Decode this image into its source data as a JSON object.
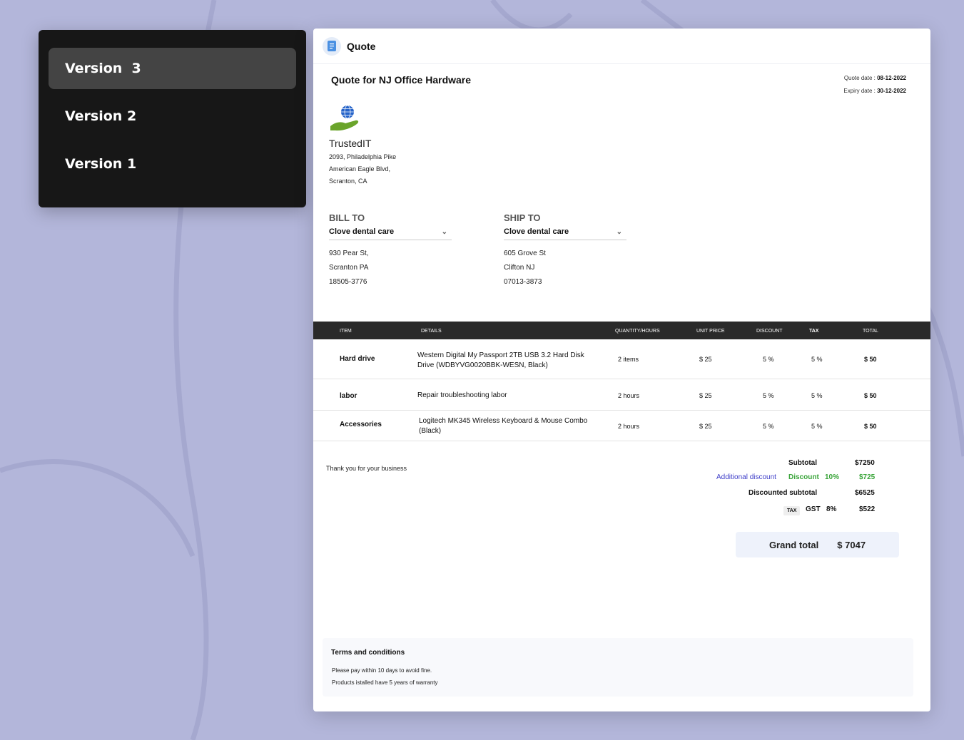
{
  "versions": [
    "Version  3",
    "Version 2",
    "Version 1"
  ],
  "doc": {
    "title": "Quote",
    "quote_for": "Quote for NJ Office Hardware",
    "quote_date_label": "Quote date : ",
    "quote_date": "08-12-2022",
    "expiry_date_label": "Expiry date : ",
    "expiry_date": "30-12-2022"
  },
  "company": {
    "name": "TrustedIT",
    "address": [
      "2093, Philadelphia Pike",
      "American Eagle Blvd,",
      "Scranton, CA"
    ]
  },
  "bill_to": {
    "heading": "BILL TO",
    "name": "Clove dental care",
    "address": [
      "930 Pear St,",
      "Scranton PA",
      "18505-3776"
    ]
  },
  "ship_to": {
    "heading": "SHIP TO",
    "name": "Clove dental care",
    "address": [
      "605 Grove St",
      "Clifton NJ",
      "07013-3873"
    ]
  },
  "table": {
    "headers": [
      "ITEM",
      "DETAILS",
      "QUANTITY/HOURS",
      "UNIT PRICE",
      "DISCOUNT",
      "TAX",
      "TOTAL"
    ],
    "rows": [
      [
        "Hard drive",
        "Western Digital My Passport 2TB USB 3.2 Hard Disk Drive (WDBYVG0020BBK-WESN, Black)",
        "2 items",
        "$ 25",
        "5 %",
        "5 %",
        "$ 50"
      ],
      [
        "labor",
        "Repair troubleshooting labor",
        "2 hours",
        "$ 25",
        "5 %",
        "5 %",
        "$ 50"
      ],
      [
        "Accessories",
        "Logitech MK345 Wireless Keyboard & Mouse Combo (Black)",
        "2 hours",
        "$ 25",
        "5 %",
        "5 %",
        "$ 50"
      ]
    ]
  },
  "thanks": "Thank you for your business",
  "summary": {
    "subtotal_label": "Subtotal",
    "subtotal": "$7250",
    "additional_discount": "Additional discount",
    "discount_label": "Discount",
    "discount_pct": "10%",
    "discount_value": "$725",
    "discounted_subtotal_label": "Discounted subtotal",
    "discounted_subtotal": "$6525",
    "tax_chip": "TAX",
    "tax_name": "GST",
    "tax_pct": "8%",
    "tax_value": "$522",
    "grand_total_label": "Grand total",
    "grand_total": "$ 7047"
  },
  "terms": {
    "title": "Terms and conditions",
    "lines": [
      "Please pay within 10 days to avoid fine.",
      "Products istalled have 5 years of warranty"
    ]
  },
  "colors": {
    "background": "#b3b6da",
    "panel": "#171717",
    "active_version": "#444444",
    "table_header": "#2a2a2a",
    "discount_link": "#3d3dc8",
    "discount_green": "#3aa53a"
  }
}
